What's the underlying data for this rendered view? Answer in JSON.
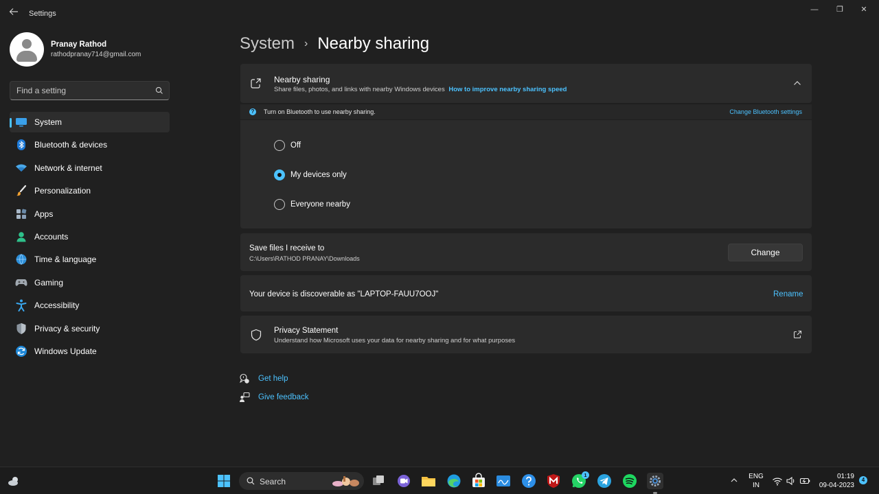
{
  "window": {
    "title": "Settings",
    "controls": {
      "minimize": "—",
      "maximize": "❐",
      "close": "✕"
    }
  },
  "profile": {
    "name": "Pranay Rathod",
    "email": "rathodpranay714@gmail.com"
  },
  "search": {
    "placeholder": "Find a setting"
  },
  "nav": [
    {
      "label": "System",
      "icon": "monitor-icon",
      "active": true
    },
    {
      "label": "Bluetooth & devices",
      "icon": "bluetooth-icon"
    },
    {
      "label": "Network & internet",
      "icon": "wifi-icon"
    },
    {
      "label": "Personalization",
      "icon": "brush-icon"
    },
    {
      "label": "Apps",
      "icon": "apps-icon"
    },
    {
      "label": "Accounts",
      "icon": "person-icon"
    },
    {
      "label": "Time & language",
      "icon": "globe-clock-icon"
    },
    {
      "label": "Gaming",
      "icon": "gamepad-icon"
    },
    {
      "label": "Accessibility",
      "icon": "accessibility-icon"
    },
    {
      "label": "Privacy & security",
      "icon": "shield-icon"
    },
    {
      "label": "Windows Update",
      "icon": "update-icon"
    }
  ],
  "breadcrumb": {
    "parent": "System",
    "separator": "›",
    "current": "Nearby sharing"
  },
  "nearby": {
    "title": "Nearby sharing",
    "subtitle": "Share files, photos, and links with nearby Windows devices",
    "link": "How to improve nearby sharing speed",
    "info_text": "Turn on Bluetooth to use nearby sharing.",
    "info_link": "Change Bluetooth settings",
    "options": [
      {
        "label": "Off",
        "checked": false
      },
      {
        "label": "My devices only",
        "checked": true
      },
      {
        "label": "Everyone nearby",
        "checked": false
      }
    ]
  },
  "save": {
    "title": "Save files I receive to",
    "path": "C:\\Users\\RATHOD PRANAY\\Downloads",
    "button": "Change"
  },
  "discover": {
    "text": "Your device is discoverable as \"LAPTOP-FAUU7OOJ\"",
    "link": "Rename"
  },
  "privacy": {
    "title": "Privacy Statement",
    "subtitle": "Understand how Microsoft uses your data for nearby sharing and for what purposes"
  },
  "help": {
    "get_help": "Get help",
    "give_feedback": "Give feedback"
  },
  "taskbar": {
    "search_label": "Search",
    "whatsapp_badge": "1",
    "apps": [
      "start-icon",
      "task-view-icon",
      "teams-chat-icon",
      "file-explorer-icon",
      "edge-icon",
      "store-icon",
      "app-tile-icon",
      "help-icon",
      "mcafee-icon",
      "whatsapp-icon",
      "telegram-icon",
      "spotify-icon",
      "settings-icon"
    ],
    "lang_top": "ENG",
    "lang_bottom": "IN",
    "time": "01:19",
    "date": "09-04-2023",
    "notification_count": "4"
  },
  "colors": {
    "accent": "#4cc2ff",
    "background": "#202020",
    "card": "#2b2b2b"
  }
}
